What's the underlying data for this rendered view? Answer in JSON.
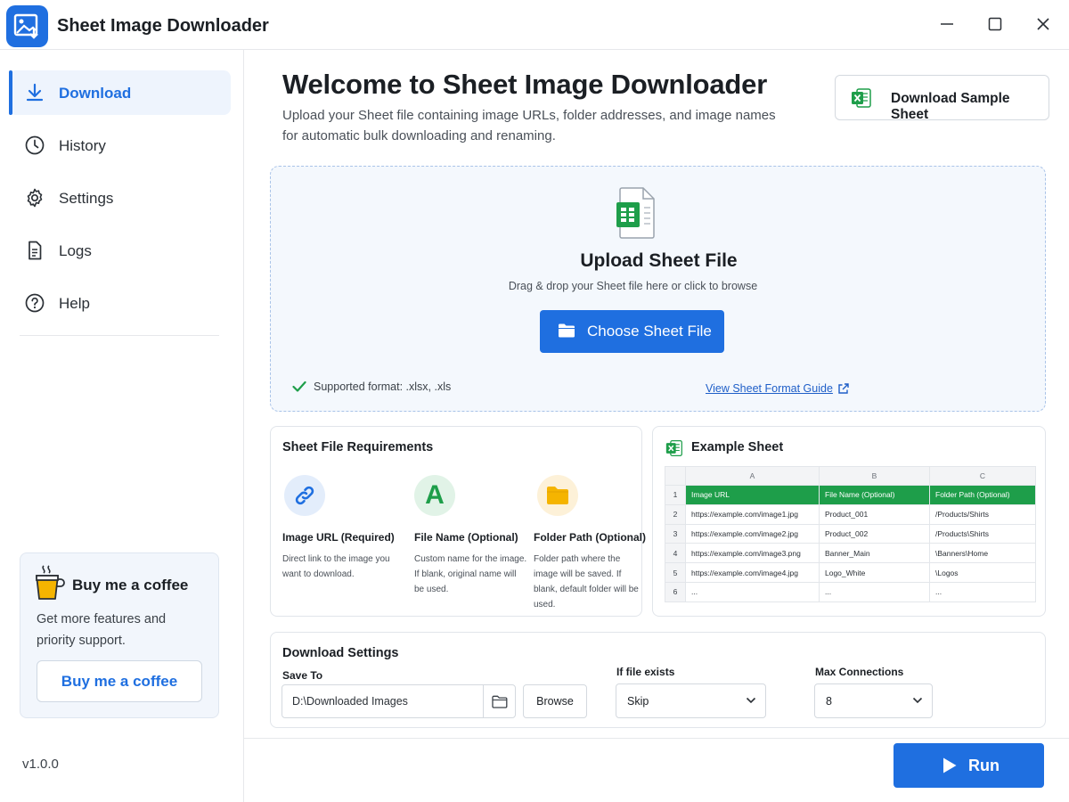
{
  "window": {
    "title": "Sheet Image Downloader"
  },
  "sidebar": {
    "items": [
      {
        "label": "Download",
        "icon": "download-icon",
        "active": true
      },
      {
        "label": "History",
        "icon": "clock-icon"
      },
      {
        "label": "Settings",
        "icon": "gear-icon"
      },
      {
        "label": "Logs",
        "icon": "document-icon"
      },
      {
        "label": "Help",
        "icon": "help-circle-icon"
      }
    ],
    "coffee": {
      "title": "Buy me a coffee",
      "description": "Get more features and priority support.",
      "button": "Buy me a coffee"
    },
    "version": "v1.0.0"
  },
  "header": {
    "title": "Welcome to Sheet Image Downloader",
    "subtitle": "Upload your Sheet file containing image URLs, folder addresses, and image names for automatic bulk downloading and renaming.",
    "sample_button": "Download Sample Sheet"
  },
  "upload": {
    "title": "Upload Sheet File",
    "subtitle": "Drag & drop your Sheet file here or click to browse",
    "button": "Choose Sheet File",
    "supported": "Supported format: .xlsx, .xls",
    "guide_link": "View Sheet Format Guide"
  },
  "requirements": {
    "title": "Sheet File Requirements",
    "items": [
      {
        "name": "Image URL (Required)",
        "desc": "Direct link to the image you want to download.",
        "icon": "link-icon"
      },
      {
        "name": "File Name (Optional)",
        "desc": "Custom name for the image. If blank, original name will be used.",
        "icon_text": "A"
      },
      {
        "name": "Folder Path (Optional)",
        "desc": "Folder path where the image will be saved. If blank, default folder will be used.",
        "icon": "folder-icon"
      }
    ]
  },
  "example": {
    "title": "Example Sheet",
    "columns": [
      "A",
      "B",
      "C"
    ],
    "rows": [
      [
        "1",
        "Image URL",
        "File Name (Optional)",
        "Folder Path (Optional)"
      ],
      [
        "2",
        "https://example.com/image1.jpg",
        "Product_001",
        "/Products/Shirts"
      ],
      [
        "3",
        "https://example.com/image2.jpg",
        "Product_002",
        "/Products\\Shirts"
      ],
      [
        "4",
        "https://example.com/image3.png",
        "Banner_Main",
        "\\Banners\\Home"
      ],
      [
        "5",
        "https://example.com/image4.jpg",
        "Logo_White",
        "\\Logos"
      ],
      [
        "6",
        "...",
        "...",
        "..."
      ]
    ]
  },
  "settings": {
    "title": "Download Settings",
    "save_to_label": "Save To",
    "save_to_value": "D:\\Downloaded Images",
    "browse_button": "Browse",
    "if_exists_label": "If file exists",
    "if_exists_value": "Skip",
    "max_conn_label": "Max Connections",
    "max_conn_value": "8"
  },
  "run_button": "Run",
  "colors": {
    "accent": "#1f6fe0",
    "excel_green": "#1e9e4a",
    "folder_yellow": "#f5b400"
  }
}
